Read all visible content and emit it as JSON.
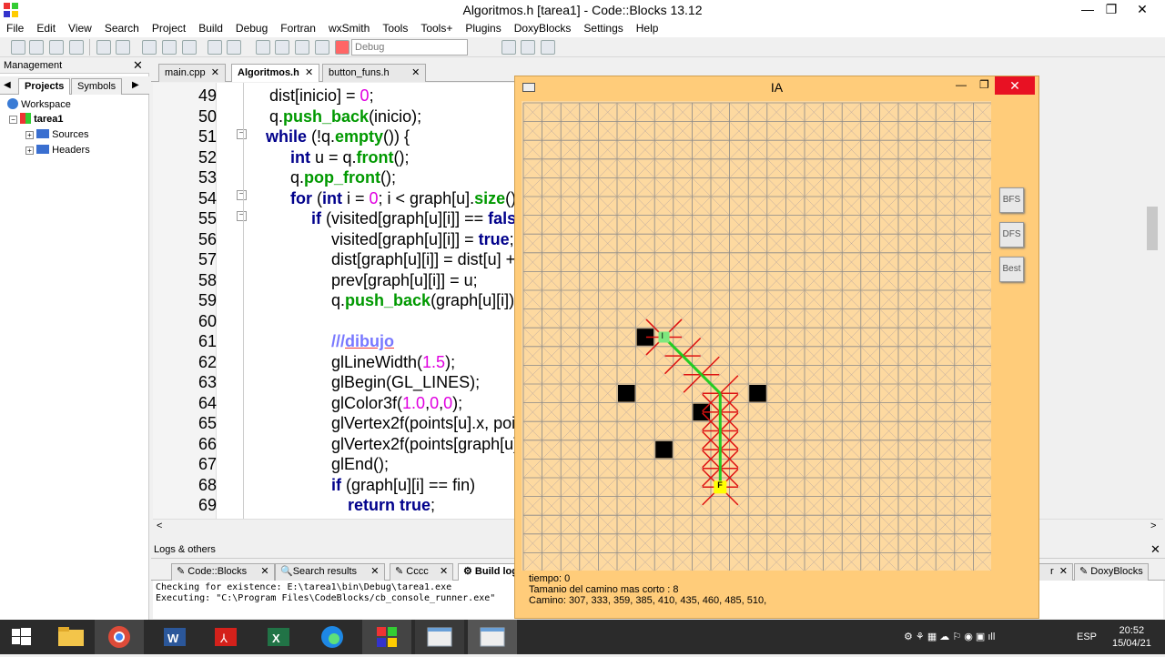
{
  "window": {
    "title": "Algoritmos.h [tarea1] - Code::Blocks 13.12",
    "minimize": "—",
    "maximize": "❐",
    "close": "✕"
  },
  "menu": [
    "File",
    "Edit",
    "View",
    "Search",
    "Project",
    "Build",
    "Debug",
    "Fortran",
    "wxSmith",
    "Tools",
    "Tools+",
    "Plugins",
    "DoxyBlocks",
    "Settings",
    "Help"
  ],
  "toolbar": {
    "build_target": "Debug"
  },
  "management": {
    "title": "Management",
    "close": "✕",
    "tabs": [
      "Projects",
      "Symbols"
    ],
    "tree": {
      "workspace": "Workspace",
      "project": "tarea1",
      "sources": "Sources",
      "headers": "Headers"
    }
  },
  "editor": {
    "tabs": [
      "main.cpp",
      "Algoritmos.h",
      "button_funs.h"
    ],
    "active_tab": "Algoritmos.h",
    "line_numbers": [
      "49",
      "50",
      "51",
      "52",
      "53",
      "54",
      "55",
      "56",
      "57",
      "58",
      "59",
      "60",
      "61",
      "62",
      "63",
      "64",
      "65",
      "66",
      "67",
      "68",
      "69"
    ]
  },
  "logs": {
    "title": "Logs & others",
    "close": "✕",
    "tabs": [
      "Code::Blocks",
      "Search results",
      "Cccc",
      "Build log",
      "DoxyBlocks"
    ],
    "lines": [
      "Checking for existence: E:\\tarea1\\bin\\Debug\\tarea1.exe",
      "Executing: \"C:\\Program Files\\CodeBlocks/cb_console_runner.exe\""
    ]
  },
  "ia_window": {
    "title": "IA",
    "minimize": "—",
    "maximize": "❐",
    "close": "✕",
    "buttons": [
      "BFS",
      "DFS",
      "Best"
    ],
    "start_label": "I",
    "end_label": "F",
    "status": {
      "tiempo": "tiempo: 0",
      "tamanio": "Tamanio del camino mas corto : 8",
      "camino": "Camino: 307, 333, 359, 385, 410, 435, 460, 485, 510,"
    }
  },
  "taskbar": {
    "lang": "ESP",
    "time": "20:52",
    "date": "15/04/21"
  },
  "colors": {
    "grid_bg": "#fdd9a0",
    "grid_line": "#888888",
    "path": "#22cc22",
    "explored": "#dd1111",
    "obstacle": "#000000",
    "start": "#7ee87e",
    "end": "#ffff00"
  }
}
